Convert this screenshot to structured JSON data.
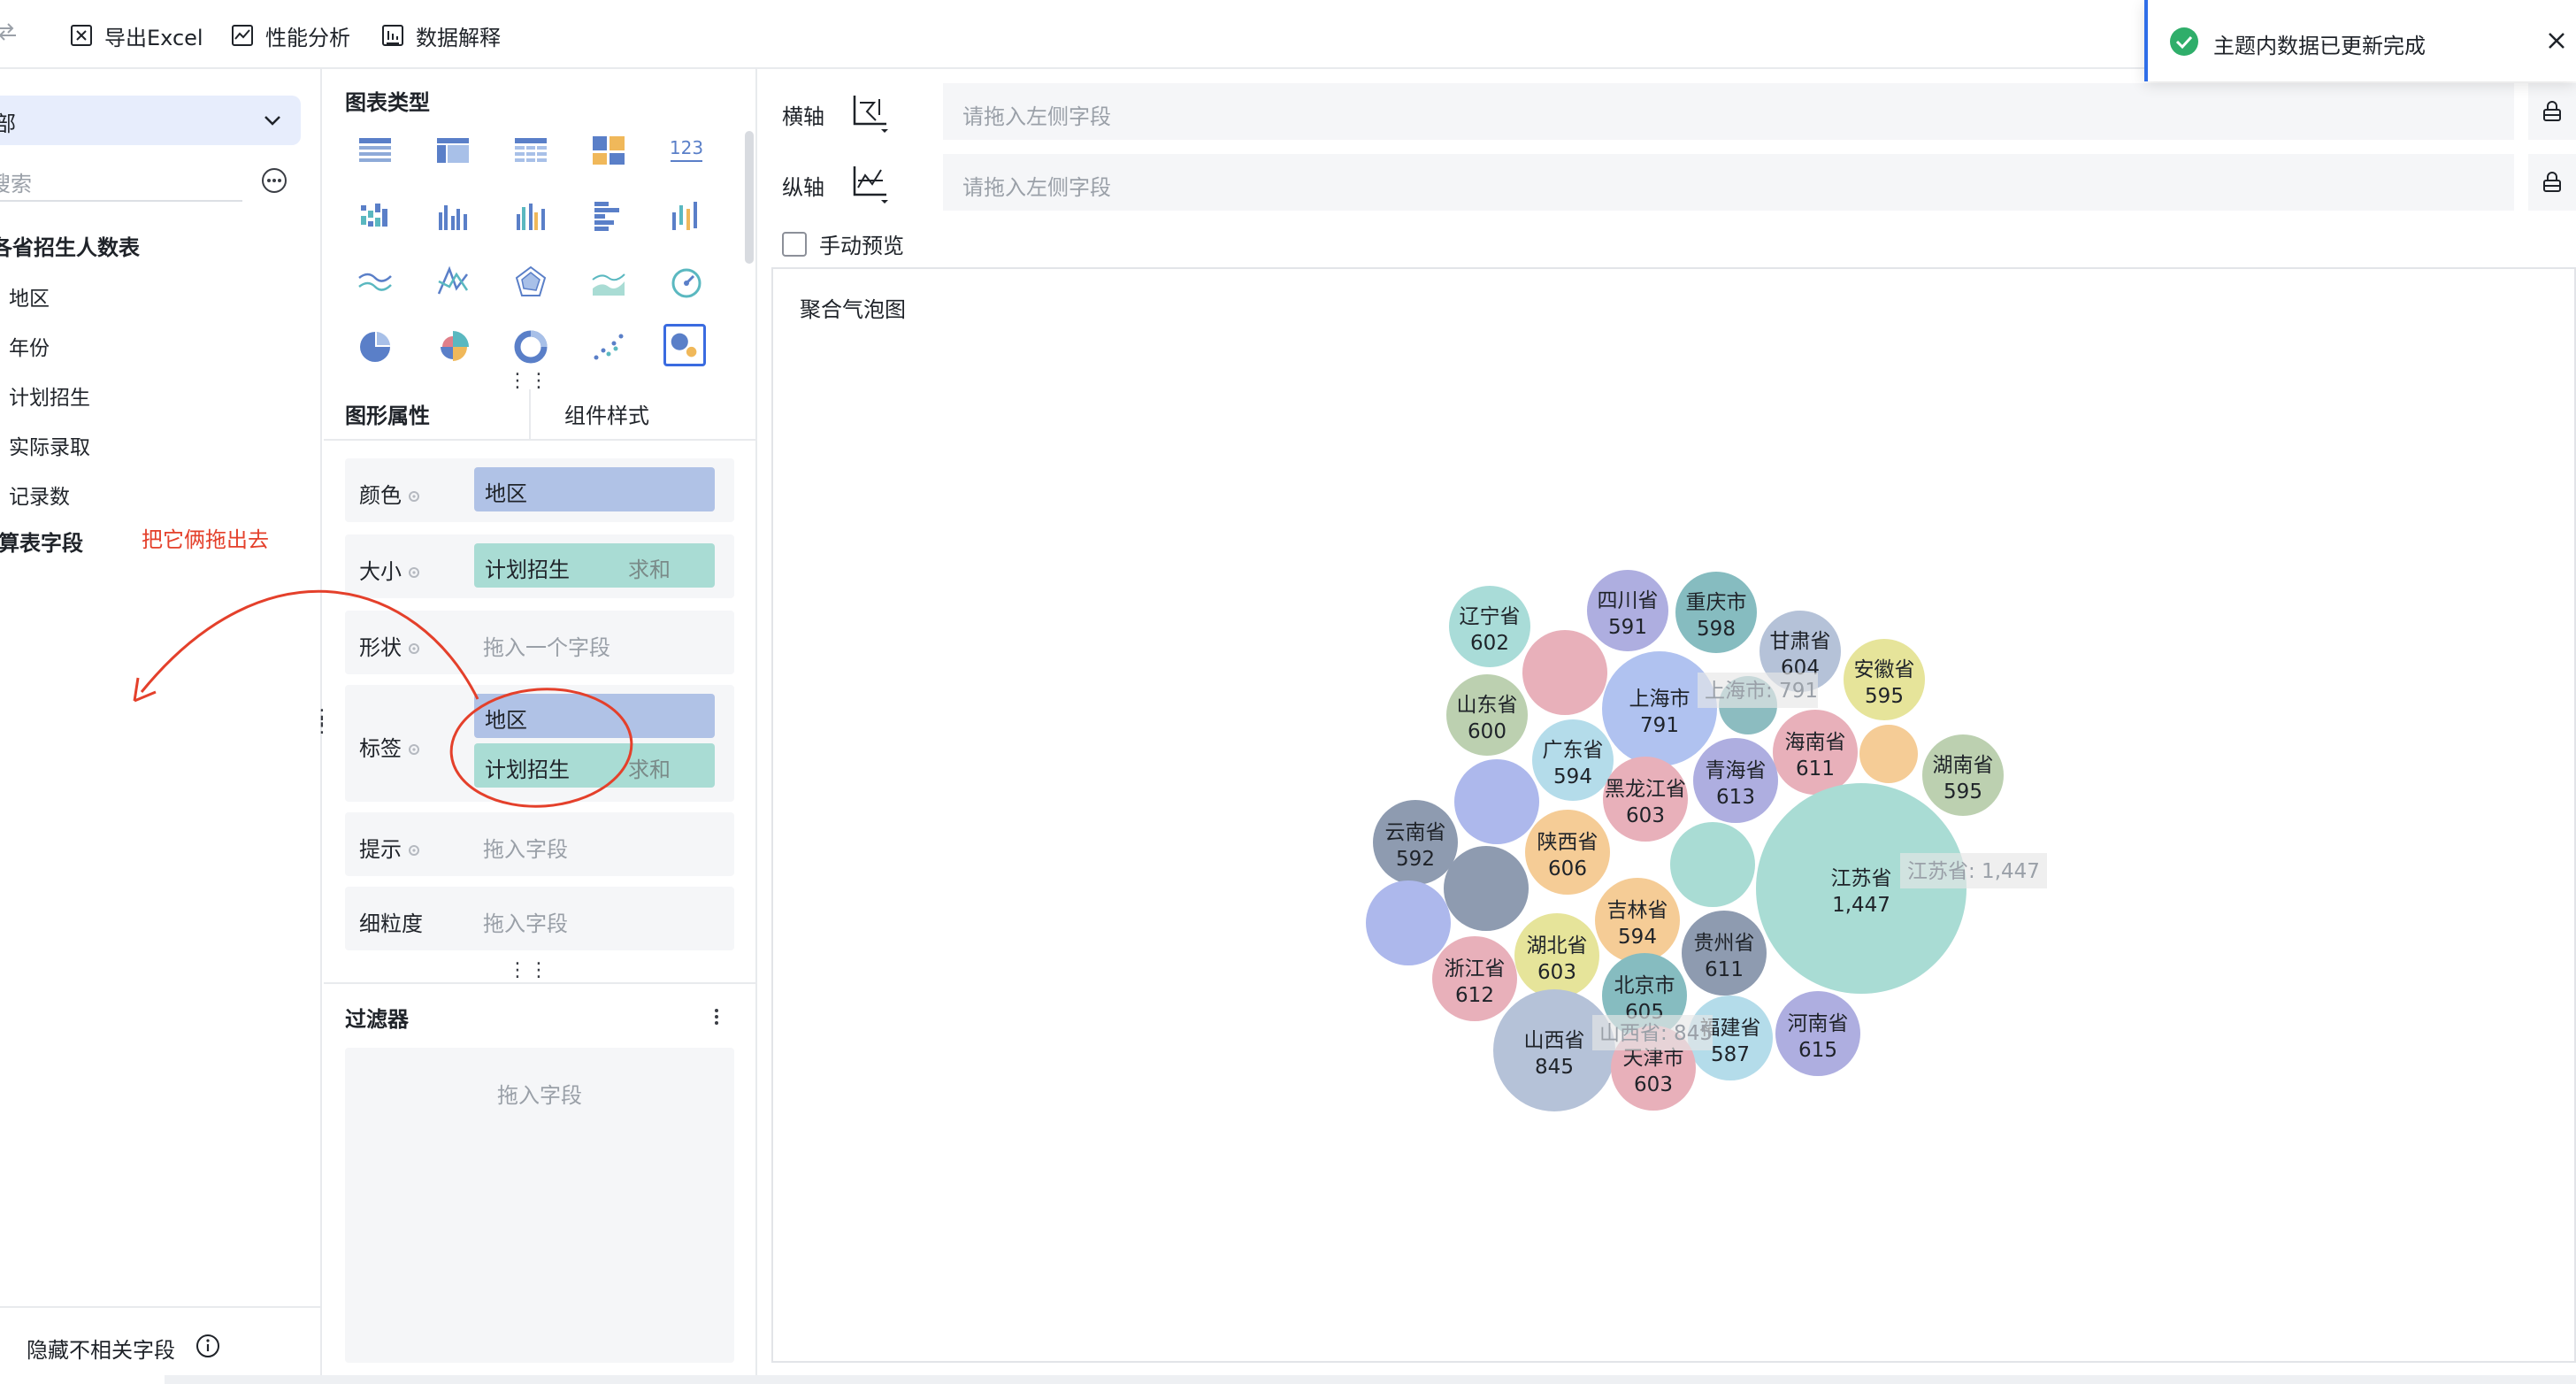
{
  "toolbar": {
    "export_label": "导出Excel",
    "perf_label": "性能分析",
    "explain_label": "数据解释"
  },
  "left": {
    "dataset_value": "部",
    "search_placeholder": "搜索",
    "table_name": "各省招生人数表",
    "fields": [
      "地区",
      "年份",
      "计划招生",
      "实际录取",
      "记录数"
    ],
    "calc_fields": "计算表字段",
    "annotation": "把它俩拖出去",
    "hide_label": "隐藏不相关字段"
  },
  "middle": {
    "chart_type_title": "图表类型",
    "tab_graphic": "图形属性",
    "tab_component": "组件样式",
    "color_label": "颜色",
    "color_value": "地区",
    "size_label": "大小",
    "size_value": "计划招生",
    "size_agg": "求和",
    "shape_label": "形状",
    "shape_placeholder": "拖入一个字段",
    "label_label": "标签",
    "label_value1": "地区",
    "label_value2": "计划招生",
    "label_agg": "求和",
    "tip_label": "提示",
    "tip_placeholder": "拖入字段",
    "granularity_label": "细粒度",
    "granularity_placeholder": "拖入字段",
    "filter_title": "过滤器",
    "filter_placeholder": "拖入字段",
    "number_icon_text": "123"
  },
  "axes": {
    "x_label": "横轴",
    "y_label": "纵轴",
    "drop_placeholder": "请拖入左侧字段"
  },
  "manual_preview": "手动预览",
  "toast": {
    "message": "主题内数据已更新完成"
  },
  "colors": {
    "accent": "#3a6be0",
    "annotation": "#e4402b",
    "pill_blue": "#b0c2e6",
    "pill_green": "#a9dcd4",
    "toast_success": "#2fae6a"
  },
  "chart_data": {
    "type": "bubble",
    "title": "聚合气泡图",
    "size_field": "计划招生",
    "color_field": "地区",
    "hover_labels": [
      "上海市: 791",
      "江苏省: 1,447",
      "山西省: 845"
    ],
    "bubbles": [
      {
        "name": "辽宁省",
        "value": 602,
        "label": "602",
        "color": "#a9dcd8"
      },
      {
        "name": "四川省",
        "value": 591,
        "label": "591",
        "color": "#aeaee0"
      },
      {
        "name": "重庆市",
        "value": 598,
        "label": "598",
        "color": "#86bcc0"
      },
      {
        "name": "甘肃省",
        "value": 604,
        "label": "604",
        "color": "#b5c2d8"
      },
      {
        "name": "安徽省",
        "value": 595,
        "label": "595",
        "color": "#e6e49a"
      },
      {
        "name": "",
        "value": 610,
        "label": "",
        "color": "#e8b0ba"
      },
      {
        "name": "上海市",
        "value": 791,
        "label": "791",
        "color": "#b0c2f0"
      },
      {
        "name": "",
        "value": 590,
        "label": "",
        "color": "#8cbcc0"
      },
      {
        "name": "山东省",
        "value": 600,
        "label": "600",
        "color": "#bcd0b0"
      },
      {
        "name": "广东省",
        "value": 594,
        "label": "594",
        "color": "#b4dcea"
      },
      {
        "name": "海南省",
        "value": 611,
        "label": "611",
        "color": "#e8b0ba"
      },
      {
        "name": "",
        "value": 590,
        "label": "",
        "color": "#f5cc96"
      },
      {
        "name": "湖南省",
        "value": 595,
        "label": "595",
        "color": "#bcd0b0"
      },
      {
        "name": "青海省",
        "value": 613,
        "label": "613",
        "color": "#aeaee0"
      },
      {
        "name": "黑龙江省",
        "value": 603,
        "label": "603",
        "color": "#e8b0ba"
      },
      {
        "name": "",
        "value": 640,
        "label": "",
        "color": "#adb8ec"
      },
      {
        "name": "云南省",
        "value": 592,
        "label": "592",
        "color": "#8e9bb0"
      },
      {
        "name": "陕西省",
        "value": 606,
        "label": "606",
        "color": "#f5cc96"
      },
      {
        "name": "",
        "value": 600,
        "label": "",
        "color": "#a9dcd4"
      },
      {
        "name": "江苏省",
        "value": 1447,
        "label": "1,447",
        "color": "#a9dcd4"
      },
      {
        "name": "",
        "value": 640,
        "label": "",
        "color": "#8e9bb0"
      },
      {
        "name": "吉林省",
        "value": 594,
        "label": "594",
        "color": "#f5cc96"
      },
      {
        "name": "",
        "value": 640,
        "label": "",
        "color": "#adb8ec"
      },
      {
        "name": "湖北省",
        "value": 603,
        "label": "603",
        "color": "#e6e49a"
      },
      {
        "name": "贵州省",
        "value": 611,
        "label": "611",
        "color": "#8e9bb0"
      },
      {
        "name": "浙江省",
        "value": 612,
        "label": "612",
        "color": "#e8b0ba"
      },
      {
        "name": "北京市",
        "value": 605,
        "label": "605",
        "color": "#86bcc0"
      },
      {
        "name": "福建省",
        "value": 587,
        "label": "587",
        "color": "#b4dcea"
      },
      {
        "name": "河南省",
        "value": 615,
        "label": "615",
        "color": "#aeaee0"
      },
      {
        "name": "山西省",
        "value": 845,
        "label": "845",
        "color": "#b5c2d8"
      },
      {
        "name": "天津市",
        "value": 603,
        "label": "603",
        "color": "#e8b0ba"
      }
    ]
  }
}
